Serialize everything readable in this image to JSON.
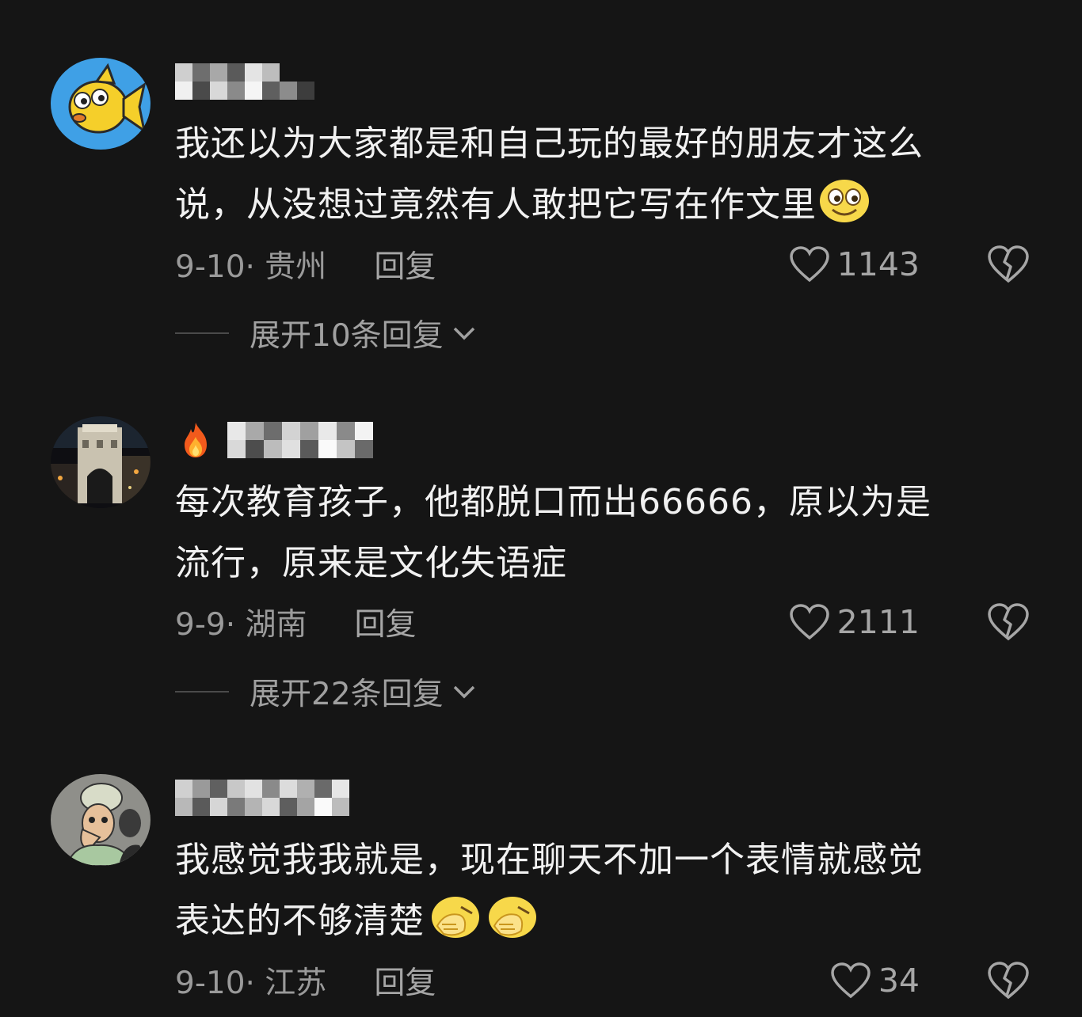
{
  "comments": [
    {
      "username": "",
      "text_line1": "我还以为大家都是和自己玩的最好的朋友才这么",
      "text_line2": "说，从没想过竟然有人敢把它写在作文里",
      "date_location": "9-10· 贵州",
      "reply_label": "回复",
      "likes": "1143",
      "expand_label": "展开10条回复"
    },
    {
      "username": "",
      "text_line1": "每次教育孩子，他都脱口而出66666，原以为是",
      "text_line2": "流行，原来是文化失语症",
      "date_location": "9-9· 湖南",
      "reply_label": "回复",
      "likes": "2111",
      "expand_label": "展开22条回复"
    },
    {
      "username": "",
      "text_line1": "我感觉我我就是，现在聊天不加一个表情就感觉",
      "text_line2": "表达的不够清楚",
      "date_location": "9-10· 江苏",
      "reply_label": "回复",
      "likes": "34"
    }
  ],
  "colors": {
    "background": "#151515",
    "primary_text": "#f1f1f1",
    "secondary_text": "#9a9a9a"
  },
  "icons": [
    "heart-icon",
    "broken-heart-icon",
    "chevron-down-icon",
    "fire-icon",
    "smile-emoji",
    "facepalm-emoji"
  ]
}
